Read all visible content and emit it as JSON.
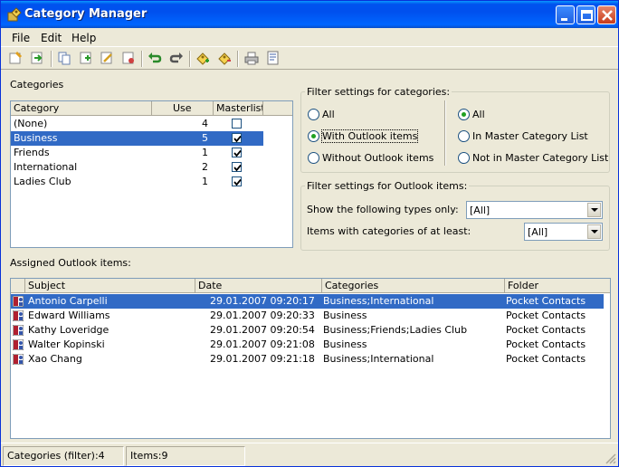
{
  "window": {
    "title": "Category Manager"
  },
  "menu": {
    "file": "File",
    "edit": "Edit",
    "help": "Help"
  },
  "toolbar_icons": [
    "new-category-icon",
    "import-icon",
    "copy-icon",
    "add-icon",
    "edit-icon",
    "delete-icon",
    "undo-icon",
    "redo-icon",
    "assign-category-icon",
    "remove-category-icon",
    "print-icon",
    "print-preview-icon"
  ],
  "categories": {
    "label": "Categories",
    "headers": {
      "category": "Category",
      "use": "Use",
      "masterlist": "Masterlist"
    },
    "rows": [
      {
        "name": "(None)",
        "use": "4",
        "master": false,
        "selected": false
      },
      {
        "name": "Business",
        "use": "5",
        "master": true,
        "selected": true
      },
      {
        "name": "Friends",
        "use": "1",
        "master": true,
        "selected": false
      },
      {
        "name": "International",
        "use": "2",
        "master": true,
        "selected": false
      },
      {
        "name": "Ladies Club",
        "use": "1",
        "master": true,
        "selected": false
      }
    ]
  },
  "filter_categories": {
    "legend": "Filter settings for categories:",
    "left_options": [
      {
        "label": "All",
        "checked": false
      },
      {
        "label": "With Outlook items",
        "checked": true
      },
      {
        "label": "Without Outlook items",
        "checked": false
      }
    ],
    "right_options": [
      {
        "label": "All",
        "checked": true
      },
      {
        "label": "In Master Category List",
        "checked": false
      },
      {
        "label": "Not in Master Category List",
        "checked": false
      }
    ]
  },
  "filter_outlook": {
    "legend": "Filter settings for Outlook items:",
    "types_label": "Show the following types only:",
    "types_value": "[All]",
    "min_label": "Items with categories of at least:",
    "min_value": "[All]"
  },
  "assigned": {
    "label": "Assigned Outlook items:",
    "headers": {
      "subject": "Subject",
      "date": "Date",
      "categories": "Categories",
      "folder": "Folder"
    },
    "rows": [
      {
        "subject": "Antonio Carpelli",
        "date": "29.01.2007 09:20:17",
        "categories": "Business;International",
        "folder": "Pocket Contacts",
        "selected": true
      },
      {
        "subject": "Edward Williams",
        "date": "29.01.2007 09:20:33",
        "categories": "Business",
        "folder": "Pocket Contacts",
        "selected": false
      },
      {
        "subject": "Kathy Loveridge",
        "date": "29.01.2007 09:20:54",
        "categories": "Business;Friends;Ladies Club",
        "folder": "Pocket Contacts",
        "selected": false
      },
      {
        "subject": "Walter Kopinski",
        "date": "29.01.2007 09:21:08",
        "categories": "Business",
        "folder": "Pocket Contacts",
        "selected": false
      },
      {
        "subject": "Xao Chang",
        "date": "29.01.2007 09:21:18",
        "categories": "Business;International",
        "folder": "Pocket Contacts",
        "selected": false
      }
    ]
  },
  "status": {
    "categories": "Categories (filter):4",
    "items": "Items:9"
  },
  "colors": {
    "selection": "#316ac5",
    "titlebar": "#0053ee",
    "face": "#ece9d8"
  }
}
